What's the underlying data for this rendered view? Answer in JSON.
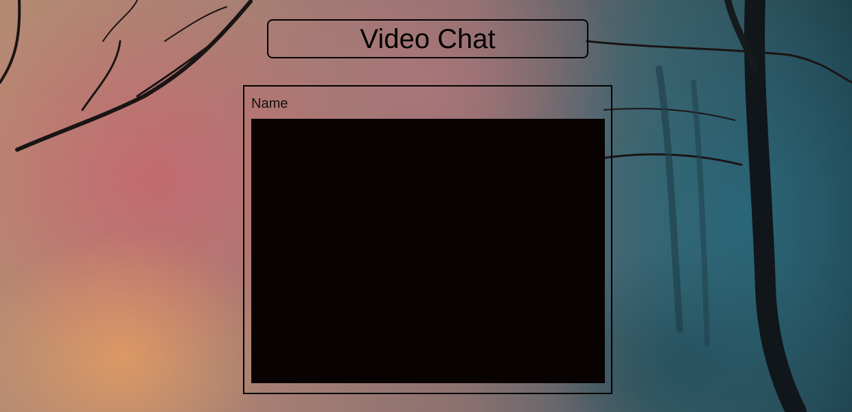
{
  "app": {
    "title": "Video Chat"
  },
  "panel": {
    "name_label": "Name"
  },
  "colors": {
    "video_background": "#090203",
    "border": "#000000"
  }
}
